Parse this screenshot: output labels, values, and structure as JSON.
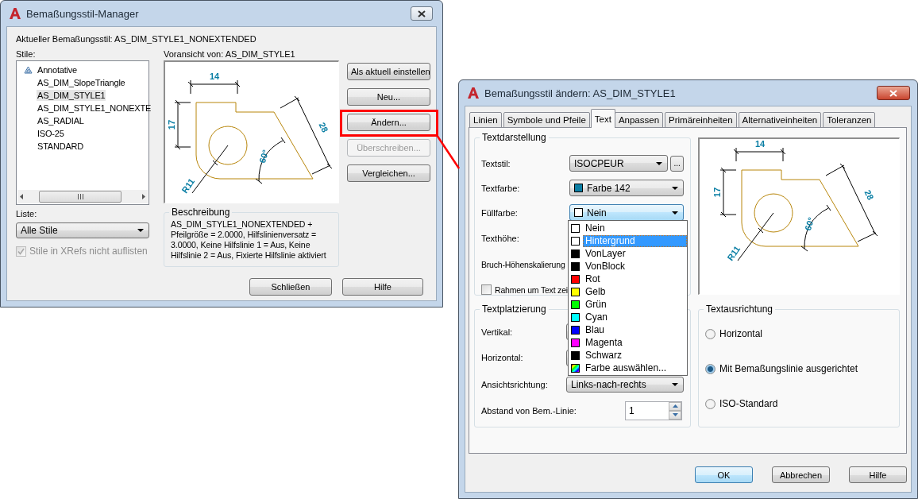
{
  "manager": {
    "title": "Bemaßungsstil-Manager",
    "current_style": "Aktueller Bemaßungsstil: AS_DIM_STYLE1_NONEXTENDED",
    "styles_label": "Stile:",
    "styles": [
      {
        "label": "Annotative",
        "annotative": true,
        "selected": false
      },
      {
        "label": "AS_DIM_SlopeTriangle",
        "annotative": false,
        "selected": false
      },
      {
        "label": "AS_DIM_STYLE1",
        "annotative": false,
        "selected": true
      },
      {
        "label": "AS_DIM_STYLE1_NONEXTE",
        "annotative": false,
        "selected": false
      },
      {
        "label": "AS_RADIAL",
        "annotative": false,
        "selected": false
      },
      {
        "label": "ISO-25",
        "annotative": false,
        "selected": false
      },
      {
        "label": "STANDARD",
        "annotative": false,
        "selected": false
      }
    ],
    "preview_label": "Voransicht von: AS_DIM_STYLE1",
    "preview_labels": [
      "14",
      "17",
      "28",
      "60°",
      "R11"
    ],
    "buttons": [
      {
        "label": "Als aktuell einstellen",
        "disabled": false
      },
      {
        "label": "Neu...",
        "disabled": false
      },
      {
        "label": "Ändern...",
        "disabled": false
      },
      {
        "label": "Überschreiben...",
        "disabled": true
      },
      {
        "label": "Vergleichen...",
        "disabled": false
      }
    ],
    "list_label": "Liste:",
    "list_value": "Alle Stile",
    "xrefs_checkbox": {
      "label": "Stile in XRefs nicht auflisten",
      "checked": true,
      "disabled": true
    },
    "description_title": "Beschreibung",
    "description": "AS_DIM_STYLE1_NONEXTENDED + Pfeilgröße = 2.0000, Hilfslinienversatz = 3.0000, Keine Hilfslinie 1 = Aus, Keine Hilfslinie 2 = Aus, Fixierte Hilfslinie aktiviert",
    "footer_buttons": [
      "Schließen",
      "Hilfe"
    ]
  },
  "editor": {
    "title": "Bemaßungsstil ändern: AS_DIM_STYLE1",
    "tabs": [
      {
        "label": "Linien",
        "selected": false
      },
      {
        "label": "Symbole und Pfeile",
        "selected": false
      },
      {
        "label": "Text",
        "selected": true
      },
      {
        "label": "Anpassen",
        "selected": false
      },
      {
        "label": "Primäreinheiten",
        "selected": false
      },
      {
        "label": "Alternativeinheiten",
        "selected": false
      },
      {
        "label": "Toleranzen",
        "selected": false
      }
    ],
    "text_appearance": {
      "title": "Textdarstellung",
      "text_style": {
        "label": "Textstil:",
        "value": "ISOCPEUR",
        "more": "..."
      },
      "text_color": {
        "label": "Textfarbe:",
        "value": "Farbe 142",
        "color": "#0a7ea4"
      },
      "fill_color": {
        "label": "Füllfarbe:",
        "value": "Nein",
        "color": "#ffffff",
        "expanded": true
      },
      "text_height_label": "Texthöhe:",
      "fraction_label": "Bruch-Höhenskalierung",
      "frame_checkbox": {
        "label": "Rahmen um Text zei",
        "checked": false
      }
    },
    "fill_color_options": [
      {
        "label": "Nein",
        "kind": "color",
        "color": "#ffffff",
        "selected": false
      },
      {
        "label": "Hintergrund",
        "kind": "color",
        "color": "#ffffff",
        "selected": true
      },
      {
        "label": "VonLayer",
        "kind": "color",
        "color": "#000000",
        "selected": false
      },
      {
        "label": "VonBlock",
        "kind": "color",
        "color": "#000000",
        "selected": false
      },
      {
        "label": "Rot",
        "kind": "color",
        "color": "#ff0000",
        "selected": false
      },
      {
        "label": "Gelb",
        "kind": "color",
        "color": "#ffff00",
        "selected": false
      },
      {
        "label": "Grün",
        "kind": "color",
        "color": "#00ff00",
        "selected": false
      },
      {
        "label": "Cyan",
        "kind": "color",
        "color": "#00ffff",
        "selected": false
      },
      {
        "label": "Blau",
        "kind": "color",
        "color": "#0000ff",
        "selected": false
      },
      {
        "label": "Magenta",
        "kind": "color",
        "color": "#ff00ff",
        "selected": false
      },
      {
        "label": "Schwarz",
        "kind": "color",
        "color": "#000000",
        "selected": false
      },
      {
        "label": "Farbe auswählen...",
        "kind": "picker",
        "selected": false
      }
    ],
    "preview_labels": [
      "14",
      "17",
      "28",
      "60°",
      "R11"
    ],
    "text_placement": {
      "title": "Textplatzierung",
      "vertical_label": "Vertikal:",
      "horizontal_label": "Horizontal:",
      "view_direction": {
        "label": "Ansichtsrichtung:",
        "value": "Links-nach-rechts"
      },
      "offset": {
        "label": "Abstand von Bem.-Linie:",
        "value": "1"
      }
    },
    "text_alignment": {
      "title": "Textausrichtung",
      "options": [
        {
          "label": "Horizontal",
          "selected": false
        },
        {
          "label": "Mit Bemaßungslinie ausgerichtet",
          "selected": true
        },
        {
          "label": "ISO-Standard",
          "selected": false
        }
      ]
    },
    "buttons": [
      {
        "label": "OK",
        "default": true
      },
      {
        "label": "Abbrechen",
        "default": false
      },
      {
        "label": "Hilfe",
        "default": false
      }
    ]
  }
}
